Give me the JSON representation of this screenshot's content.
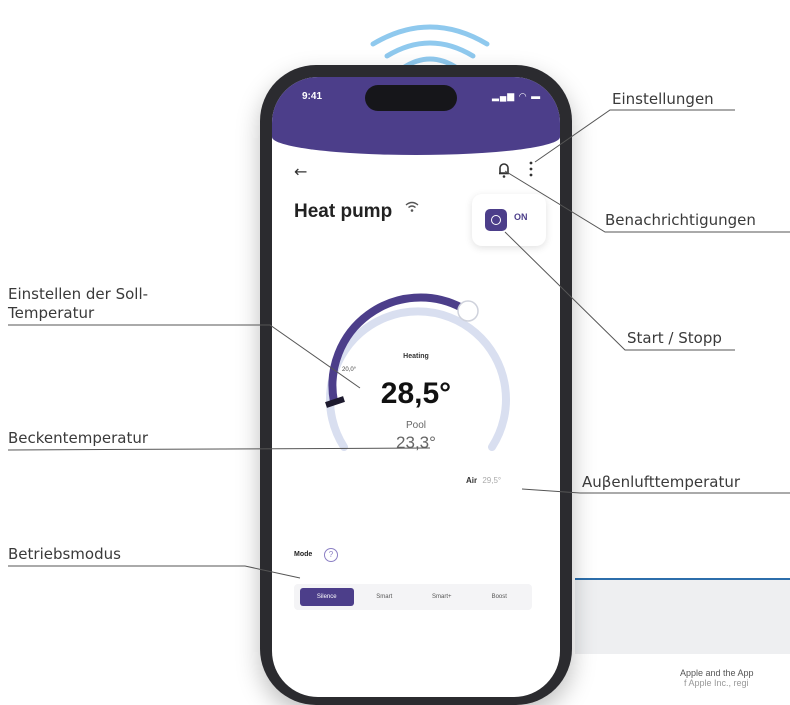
{
  "app": {
    "status_time": "9:41",
    "status_icons": "▂▄▆ ◠ ▬",
    "back_glyph": "←",
    "device_title": "Heat pump",
    "power_label": "ON",
    "heating_label": "Heating",
    "min_temp_label": "20,0°",
    "setpoint": "28,5°",
    "pool_label": "Pool",
    "pool_temp": "23,3°",
    "air_label": "Air",
    "air_temp": "29,5°",
    "mode_label": "Mode",
    "mode_help": "?",
    "modes": [
      "Silence",
      "Smart",
      "Smart+",
      "Boost"
    ],
    "active_mode": "Silence",
    "setpoint_fraction": 0.85,
    "accent_color": "#4c3e8a"
  },
  "callouts": {
    "settings": "Einstellungen",
    "notifications": "Benachrichtigungen",
    "set_temperature": [
      "Einstellen der Soll-",
      "Temperatur"
    ],
    "start_stop": "Start / Stopp",
    "pool_temperature": "Beckentemperatur",
    "outside_temperature": "Auβenlufttemperatur",
    "operating_mode": "Betriebsmodus"
  },
  "footnote": {
    "line1": "Apple and the App",
    "line2": "f Apple Inc., regi"
  }
}
